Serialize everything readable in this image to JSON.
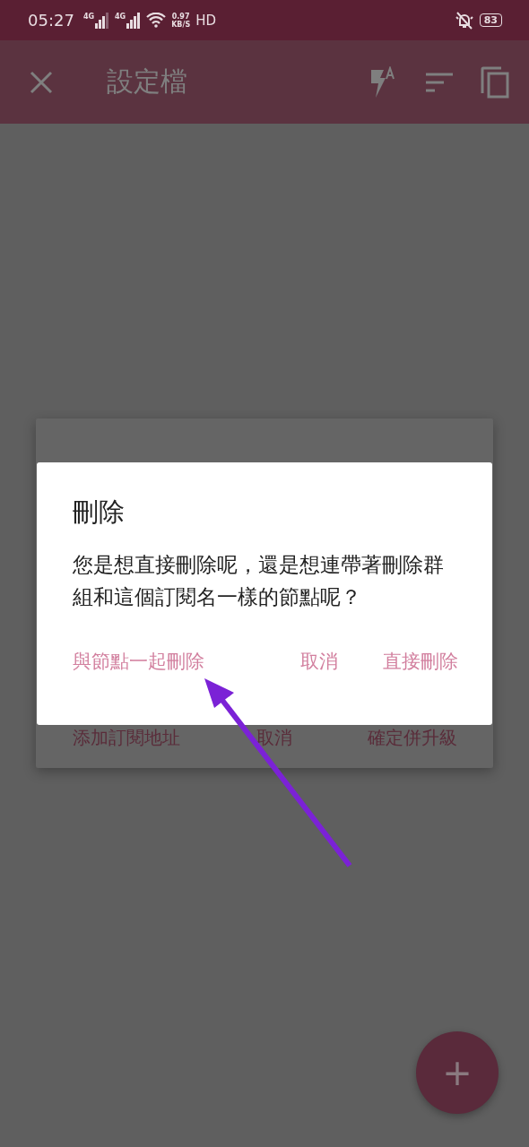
{
  "status_bar": {
    "time": "05:27",
    "network_1": "4G",
    "network_2": "4G",
    "speed_value": "0.97",
    "speed_unit": "KB/S",
    "hd": "HD",
    "battery": "83"
  },
  "app_bar": {
    "title": "設定檔"
  },
  "back_dialog": {
    "buttons": [
      "添加訂閱地址",
      "取消",
      "確定併升級"
    ]
  },
  "dialog": {
    "title": "刪除",
    "message": "您是想直接刪除呢，還是想連帶著刪除群組和這個訂閱名一樣的節點呢？",
    "buttons": [
      "與節點一起刪除",
      "取消",
      "直接刪除"
    ]
  },
  "fab": {
    "label": "+"
  }
}
